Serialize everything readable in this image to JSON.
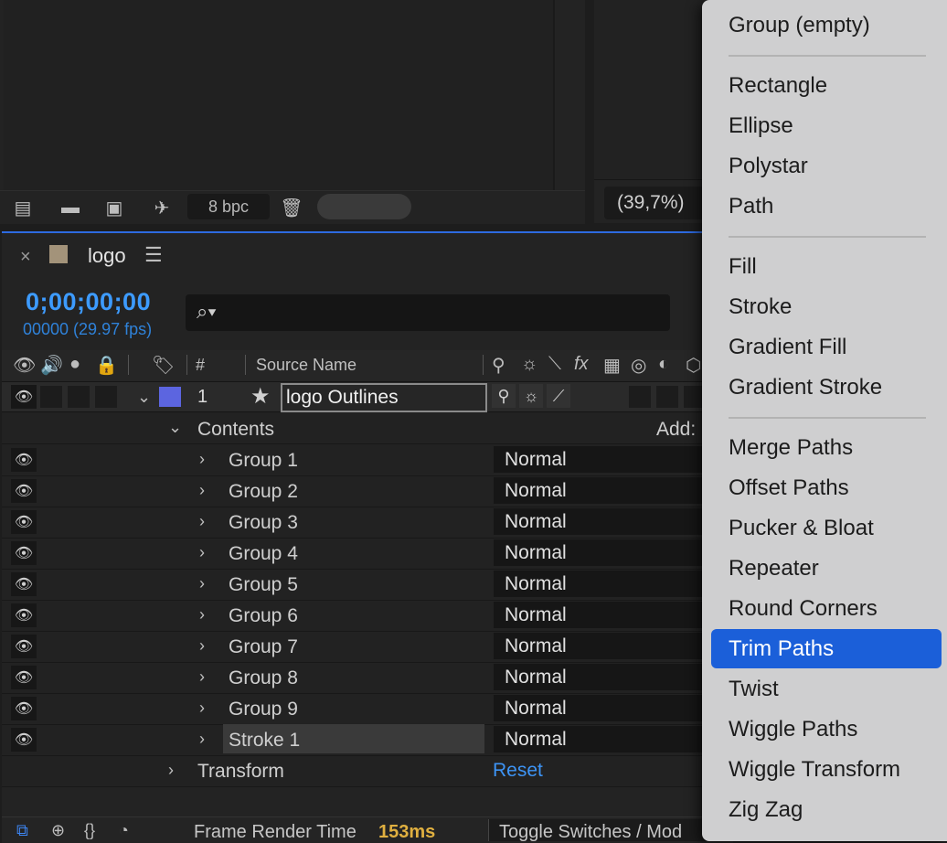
{
  "project_panel": {
    "bpc_label": "8 bpc"
  },
  "comp_viewer": {
    "zoom_label": "(39,7%)"
  },
  "timeline": {
    "tab_name": "logo",
    "close_glyph": "×",
    "timecode": "0;00;00;00",
    "frame_info": "00000 (29.97 fps)",
    "columns": {
      "number": "#",
      "source_name": "Source Name"
    },
    "layer": {
      "number": "1",
      "name": "logo Outlines"
    },
    "contents_label": "Contents",
    "add_label": "Add:",
    "groups": [
      {
        "name": "Group 1",
        "mode": "Normal"
      },
      {
        "name": "Group 2",
        "mode": "Normal"
      },
      {
        "name": "Group 3",
        "mode": "Normal"
      },
      {
        "name": "Group 4",
        "mode": "Normal"
      },
      {
        "name": "Group 5",
        "mode": "Normal"
      },
      {
        "name": "Group 6",
        "mode": "Normal"
      },
      {
        "name": "Group 7",
        "mode": "Normal"
      },
      {
        "name": "Group 8",
        "mode": "Normal"
      },
      {
        "name": "Group 9",
        "mode": "Normal"
      },
      {
        "name": "Stroke 1",
        "mode": "Normal"
      }
    ],
    "transform_label": "Transform",
    "reset_label": "Reset",
    "status": {
      "render_label": "Frame Render Time",
      "render_value": "153ms",
      "toggle_label": "Toggle Switches / Mod"
    }
  },
  "add_menu": {
    "items": [
      "Group (empty)",
      "Rectangle",
      "Ellipse",
      "Polystar",
      "Path",
      "Fill",
      "Stroke",
      "Gradient Fill",
      "Gradient Stroke",
      "Merge Paths",
      "Offset Paths",
      "Pucker & Bloat",
      "Repeater",
      "Round Corners",
      "Trim Paths",
      "Twist",
      "Wiggle Paths",
      "Wiggle Transform",
      "Zig Zag"
    ],
    "highlighted": "Trim Paths",
    "highlight_color": "#1b5fd9"
  },
  "colors": {
    "timecode": "#3d9bff",
    "layer_label": "#5c65e0",
    "render_value": "#e0b040"
  }
}
